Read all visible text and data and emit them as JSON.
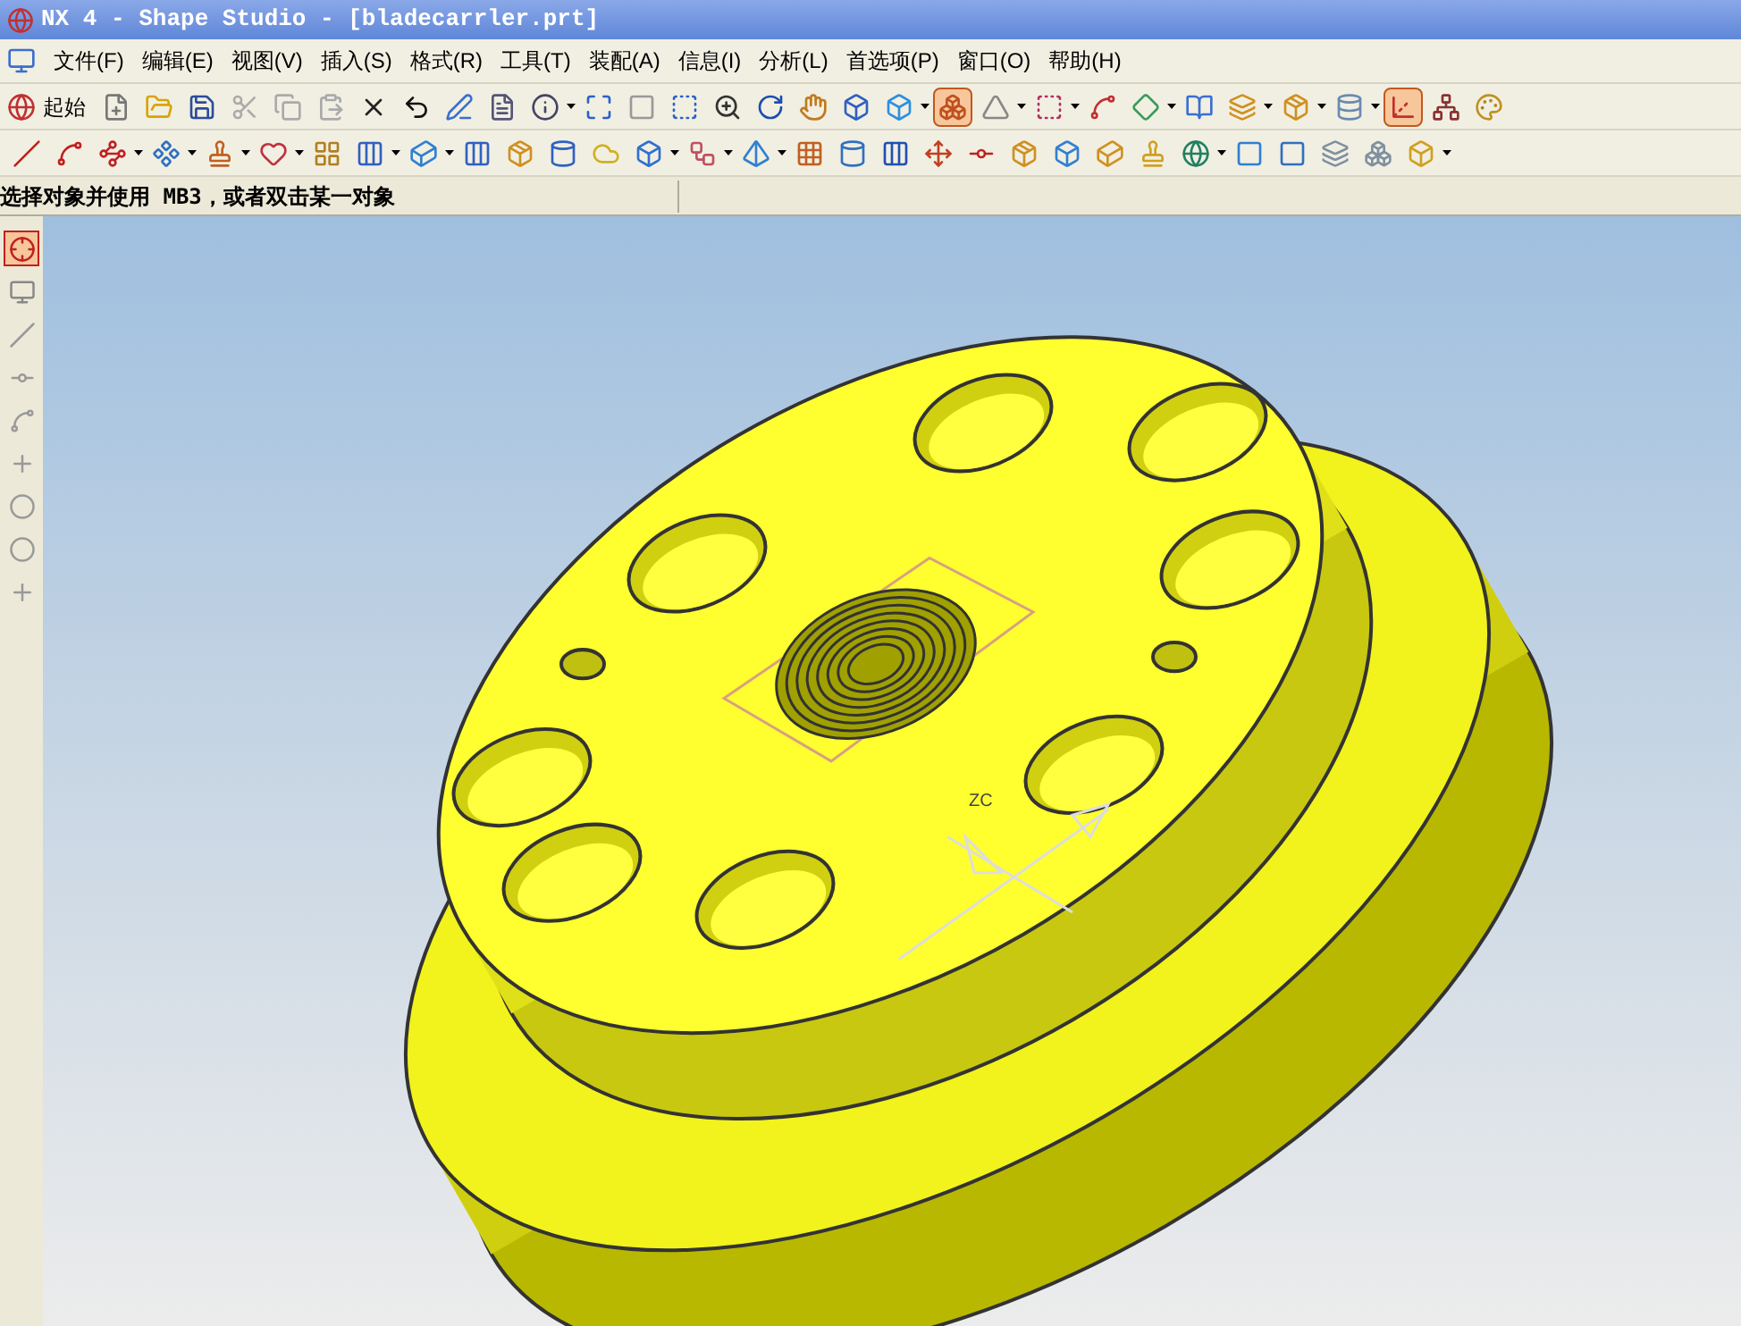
{
  "window": {
    "title": "NX 4 - Shape Studio - [bladecarrler.prt]"
  },
  "menu": [
    "文件(F)",
    "编辑(E)",
    "视图(V)",
    "插入(S)",
    "格式(R)",
    "工具(T)",
    "装配(A)",
    "信息(I)",
    "分析(L)",
    "首选项(P)",
    "窗口(O)",
    "帮助(H)"
  ],
  "toolbar_row_1": {
    "start_label": "起始",
    "buttons": [
      {
        "selected": false
      },
      {
        "selected": false
      },
      {
        "selected": false
      },
      {
        "selected": false
      },
      {
        "selected": false
      },
      {
        "selected": false
      },
      {
        "selected": false
      },
      {
        "selected": false
      },
      {
        "selected": false
      },
      {
        "selected": false
      },
      {
        "selected": false
      },
      {
        "selected": false
      },
      {
        "selected": false
      },
      {
        "selected": false
      },
      {
        "selected": false
      },
      {
        "selected": false
      },
      {
        "selected": false
      },
      {
        "selected": false
      },
      {
        "selected": false
      },
      {
        "selected": true
      },
      {
        "selected": false
      },
      {
        "selected": false
      },
      {
        "selected": false
      },
      {
        "selected": false
      },
      {
        "selected": false
      },
      {
        "selected": false
      },
      {
        "selected": false
      },
      {
        "selected": false
      },
      {
        "selected": true
      },
      {
        "selected": false
      },
      {
        "selected": false
      }
    ]
  },
  "toolbar_row_2": {
    "buttons": [
      {
        "selected": false
      },
      {
        "selected": false
      },
      {
        "selected": false
      },
      {
        "selected": false
      },
      {
        "selected": false
      },
      {
        "selected": false
      },
      {
        "selected": false
      },
      {
        "selected": false
      },
      {
        "selected": false
      },
      {
        "selected": false
      },
      {
        "selected": false
      },
      {
        "selected": false
      },
      {
        "selected": false
      },
      {
        "selected": false
      },
      {
        "selected": false
      },
      {
        "selected": false
      },
      {
        "selected": false
      },
      {
        "selected": false
      },
      {
        "selected": false
      },
      {
        "selected": false
      },
      {
        "selected": false
      },
      {
        "selected": false
      },
      {
        "selected": false
      },
      {
        "selected": false
      },
      {
        "selected": false
      },
      {
        "selected": false
      },
      {
        "selected": false
      },
      {
        "selected": false
      },
      {
        "selected": false
      },
      {
        "selected": false
      },
      {
        "selected": false
      }
    ]
  },
  "status_bar": {
    "prompt": "选择对象并使用 MB3，或者双击某一对象"
  },
  "left_toolbar": {
    "buttons": [
      {
        "selected": true
      },
      {
        "selected": false
      },
      {
        "selected": false
      },
      {
        "selected": false
      },
      {
        "selected": false
      },
      {
        "selected": false
      },
      {
        "selected": false
      },
      {
        "selected": false
      },
      {
        "selected": false
      }
    ]
  },
  "viewport": {
    "axis_label": "ZC"
  }
}
